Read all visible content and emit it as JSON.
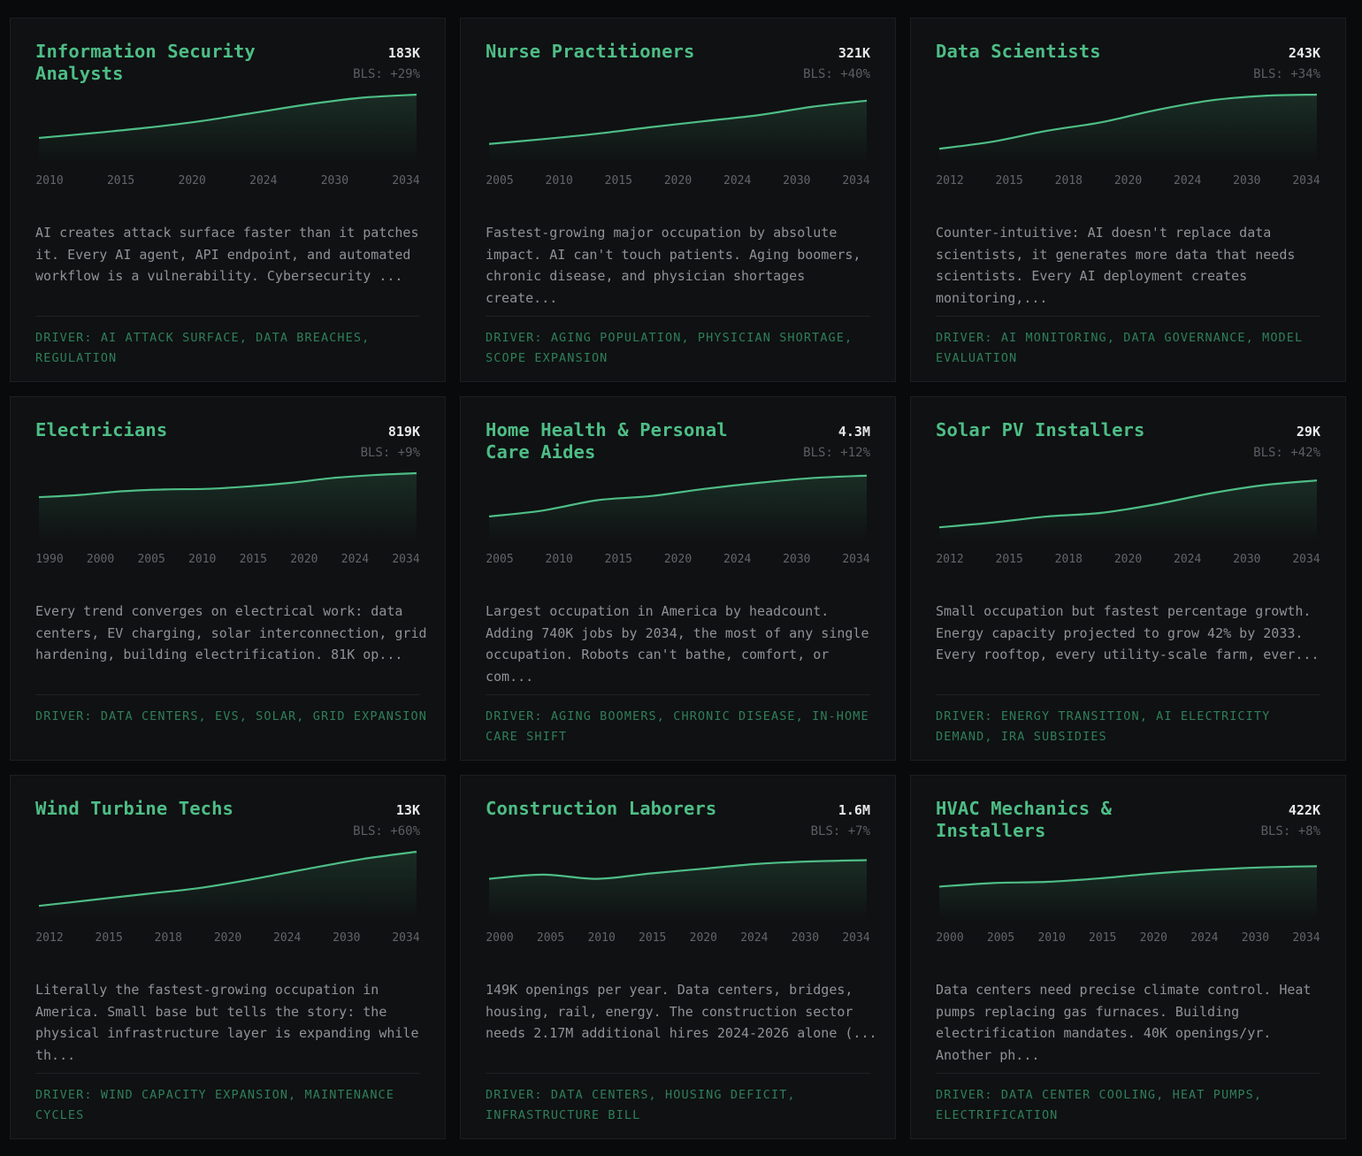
{
  "cards": [
    {
      "title": "Information Security Analysts",
      "count": "183K",
      "bls": "BLS: +29%",
      "years": [
        "2010",
        "2015",
        "2020",
        "2024",
        "2030",
        "2034"
      ],
      "trend": [
        0.28,
        0.36,
        0.45,
        0.56,
        0.7,
        0.84,
        0.95,
        1.0
      ],
      "description": "AI creates attack surface faster than it patches it. Every AI agent, API endpoint, and automated workflow is a vulnerability. Cybersecurity ...",
      "driver": "DRIVER: AI ATTACK SURFACE, DATA BREACHES, REGULATION"
    },
    {
      "title": "Nurse Practitioners",
      "count": "321K",
      "bls": "BLS: +40%",
      "years": [
        "2005",
        "2010",
        "2015",
        "2020",
        "2024",
        "2030",
        "2034"
      ],
      "trend": [
        0.18,
        0.26,
        0.35,
        0.46,
        0.56,
        0.66,
        0.8,
        0.9
      ],
      "description": "Fastest-growing major occupation by absolute impact. AI can't touch patients. Aging boomers, chronic disease, and physician shortages create...",
      "driver": "DRIVER: AGING POPULATION, PHYSICIAN SHORTAGE, SCOPE EXPANSION"
    },
    {
      "title": "Data Scientists",
      "count": "243K",
      "bls": "BLS: +34%",
      "years": [
        "2012",
        "2015",
        "2018",
        "2020",
        "2024",
        "2030",
        "2034"
      ],
      "trend": [
        0.1,
        0.22,
        0.4,
        0.54,
        0.74,
        0.9,
        0.98,
        1.0
      ],
      "description": "Counter-intuitive: AI doesn't replace data scientists, it generates more data that needs scientists. Every AI deployment creates monitoring,...",
      "driver": "DRIVER: AI MONITORING, DATA GOVERNANCE, MODEL EVALUATION"
    },
    {
      "title": "Electricians",
      "count": "819K",
      "bls": "BLS: +9%",
      "years": [
        "1990",
        "2000",
        "2005",
        "2010",
        "2015",
        "2020",
        "2024",
        "2034"
      ],
      "trend": [
        0.6,
        0.64,
        0.7,
        0.73,
        0.74,
        0.78,
        0.84,
        0.92,
        0.97,
        1.0
      ],
      "description": "Every trend converges on electrical work: data centers, EV charging, solar interconnection, grid hardening, building electrification. 81K op...",
      "driver": "DRIVER: DATA CENTERS, EVS, SOLAR, GRID EXPANSION"
    },
    {
      "title": "Home Health & Personal Care Aides",
      "count": "4.3M",
      "bls": "BLS: +12%",
      "years": [
        "2005",
        "2010",
        "2015",
        "2020",
        "2024",
        "2030",
        "2034"
      ],
      "trend": [
        0.28,
        0.38,
        0.55,
        0.62,
        0.74,
        0.84,
        0.92,
        0.96
      ],
      "description": "Largest occupation in America by headcount. Adding 740K jobs by 2034, the most of any single occupation. Robots can't bathe, comfort, or com...",
      "driver": "DRIVER: AGING BOOMERS, CHRONIC DISEASE, IN-HOME CARE SHIFT"
    },
    {
      "title": "Solar PV Installers",
      "count": "29K",
      "bls": "BLS: +42%",
      "years": [
        "2012",
        "2015",
        "2018",
        "2020",
        "2024",
        "2030",
        "2034"
      ],
      "trend": [
        0.1,
        0.18,
        0.28,
        0.34,
        0.48,
        0.66,
        0.8,
        0.88
      ],
      "description": "Small occupation but fastest percentage growth. Energy capacity projected to grow 42% by 2033. Every rooftop, every utility-scale farm, ever...",
      "driver": "DRIVER: ENERGY TRANSITION, AI ELECTRICITY DEMAND, IRA SUBSIDIES"
    },
    {
      "title": "Wind Turbine Techs",
      "count": "13K",
      "bls": "BLS: +60%",
      "years": [
        "2012",
        "2015",
        "2018",
        "2020",
        "2024",
        "2030",
        "2034"
      ],
      "trend": [
        0.1,
        0.2,
        0.3,
        0.4,
        0.55,
        0.72,
        0.88,
        1.0
      ],
      "description": "Literally the fastest-growing occupation in America. Small base but tells the story: the physical infrastructure layer is expanding while th...",
      "driver": "DRIVER: WIND CAPACITY EXPANSION, MAINTENANCE CYCLES"
    },
    {
      "title": "Construction Laborers",
      "count": "1.6M",
      "bls": "BLS: +7%",
      "years": [
        "2000",
        "2005",
        "2010",
        "2015",
        "2020",
        "2024",
        "2030",
        "2034"
      ],
      "trend": [
        0.55,
        0.62,
        0.55,
        0.64,
        0.72,
        0.8,
        0.84,
        0.86
      ],
      "description": "149K openings per year. Data centers, bridges, housing, rail, energy. The construction sector needs 2.17M additional hires 2024-2026 alone (...",
      "driver": "DRIVER: DATA CENTERS, HOUSING DEFICIT, INFRASTRUCTURE BILL"
    },
    {
      "title": "HVAC Mechanics & Installers",
      "count": "422K",
      "bls": "BLS: +8%",
      "years": [
        "2000",
        "2005",
        "2010",
        "2015",
        "2020",
        "2024",
        "2030",
        "2034"
      ],
      "trend": [
        0.42,
        0.48,
        0.5,
        0.56,
        0.64,
        0.7,
        0.74,
        0.76
      ],
      "description": "Data centers need precise climate control. Heat pumps replacing gas furnaces. Building electrification mandates. 40K openings/yr. Another ph...",
      "driver": "DRIVER: DATA CENTER COOLING, HEAT PUMPS, ELECTRIFICATION"
    }
  ],
  "colors": {
    "accent": "#4ebd86",
    "driver": "#2f7f5a",
    "card_bg": "#0f1112",
    "page_bg": "#090a0b"
  }
}
